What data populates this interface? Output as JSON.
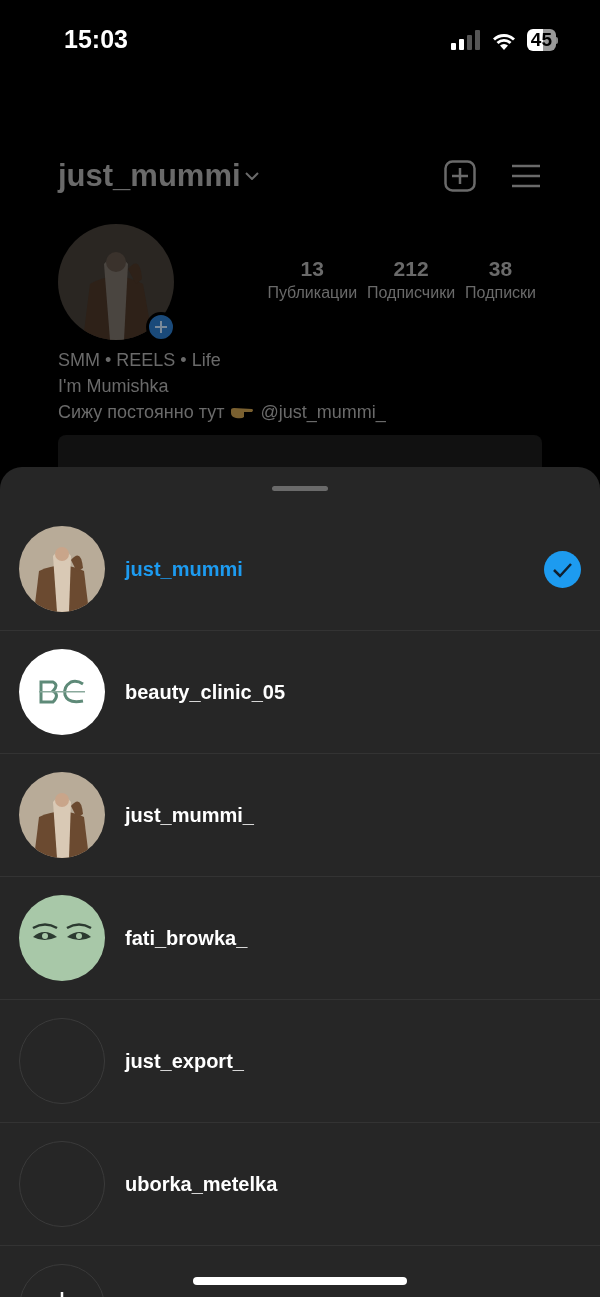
{
  "status_bar": {
    "time": "15:03",
    "battery": "45"
  },
  "profile": {
    "username": "just_mummi",
    "stats": [
      {
        "value": "13",
        "label": "Публикации"
      },
      {
        "value": "212",
        "label": "Подписчики"
      },
      {
        "value": "38",
        "label": "Подписки"
      }
    ],
    "bio": [
      "SMM • REELS • Life",
      "I'm Mumishka"
    ],
    "bio_line": {
      "text": "Сижу постоянно тут",
      "link": "@just_mummi_"
    }
  },
  "accounts": [
    {
      "username": "just_mummi",
      "selected": true
    },
    {
      "username": "beauty_clinic_05",
      "kind": "logo",
      "selected": false
    },
    {
      "username": "just_mummi_",
      "selected": false
    },
    {
      "username": "fati_browka_",
      "kind": "eyes",
      "selected": false
    },
    {
      "username": "just_export_",
      "kind": "empty",
      "selected": false
    },
    {
      "username": "uborka_metelka",
      "kind": "empty",
      "selected": false
    },
    {
      "kind": "add",
      "selected": false
    }
  ]
}
